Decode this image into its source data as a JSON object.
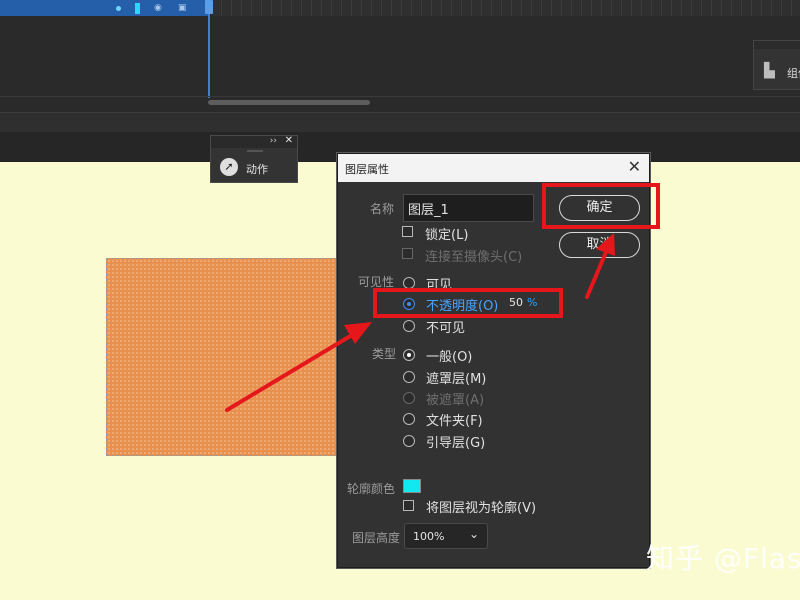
{
  "timeline": {
    "side_panel_label": "组件"
  },
  "action_panel": {
    "label": "动作"
  },
  "dialog": {
    "title": "图层属性",
    "name_label": "名称",
    "name_value": "图层_1",
    "lock_label": "锁定(L)",
    "camera_label": "连接至摄像头(C)",
    "visibility_label": "可见性",
    "visible_label": "可见",
    "opacity_label": "不透明度(O)",
    "opacity_value": "50",
    "opacity_unit": "%",
    "invisible_label": "不可见",
    "type_label": "类型",
    "type_options": [
      "一般(O)",
      "遮罩层(M)",
      "被遮罩(A)",
      "文件夹(F)",
      "引导层(G)"
    ],
    "outline_color_label": "轮廓颜色",
    "outline_color": "#12e8f0",
    "view_as_outline_label": "将图层视为轮廓(V)",
    "layer_height_label": "图层高度",
    "layer_height_value": "100%",
    "ok_label": "确定",
    "cancel_label": "取消"
  },
  "colors": {
    "stage_background": "#fbfbd2",
    "rectangle_fill": "#e8914f",
    "annotation_red": "#e5171b",
    "accent_blue": "#3d8ef0"
  },
  "watermark": "知乎 @Flas"
}
